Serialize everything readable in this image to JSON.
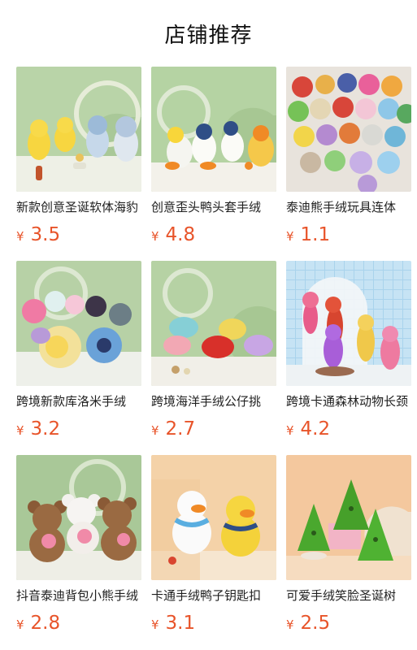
{
  "page": {
    "title": "店铺推荐"
  },
  "currency_symbol": "¥",
  "products": [
    {
      "name": "新款创意圣诞软体海豹",
      "price": "3.5",
      "scene": "chicks"
    },
    {
      "name": "创意歪头鸭头套手绒",
      "price": "4.8",
      "scene": "ducks"
    },
    {
      "name": "泰迪熊手绒玩具连体",
      "price": "1.1",
      "scene": "bears"
    },
    {
      "name": "跨境新款库洛米手绒",
      "price": "3.2",
      "scene": "kuromi"
    },
    {
      "name": "跨境海洋手绒公仔挑",
      "price": "2.7",
      "scene": "crabs"
    },
    {
      "name": "跨境卡通森林动物长颈",
      "price": "4.2",
      "scene": "deer"
    },
    {
      "name": "抖音泰迪背包小熊手绒",
      "price": "2.8",
      "scene": "brownbears"
    },
    {
      "name": "卡通手绒鸭子钥匙扣",
      "price": "3.1",
      "scene": "duckkeychain"
    },
    {
      "name": "可爱手绒笑脸圣诞树",
      "price": "2.5",
      "scene": "trees"
    }
  ]
}
